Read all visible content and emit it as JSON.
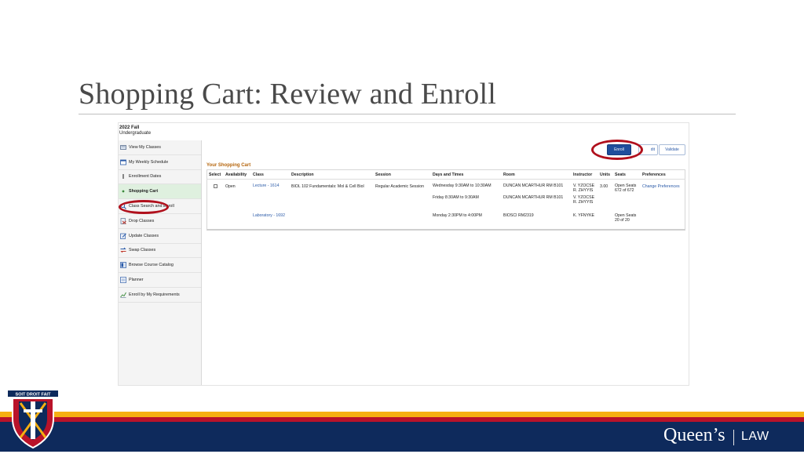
{
  "slide": {
    "title": "Shopping Cart: Review and Enroll"
  },
  "term": {
    "name": "2022 Fall",
    "career": "Undergraduate"
  },
  "sidebar": {
    "items": [
      {
        "label": "View My Classes",
        "icon": "view-classes-icon"
      },
      {
        "label": "My Weekly Schedule",
        "icon": "weekly-schedule-icon"
      },
      {
        "label": "Enrollment Dates",
        "icon": "enrollment-dates-icon"
      },
      {
        "label": "Shopping Cart",
        "icon": "shopping-cart-icon"
      },
      {
        "label": "Class Search and Enroll",
        "icon": "search-icon"
      },
      {
        "label": "Drop Classes",
        "icon": "drop-classes-icon"
      },
      {
        "label": "Update Classes",
        "icon": "update-classes-icon"
      },
      {
        "label": "Swap Classes",
        "icon": "swap-classes-icon"
      },
      {
        "label": "Browse Course Catalog",
        "icon": "catalog-icon"
      },
      {
        "label": "Planner",
        "icon": "planner-icon"
      },
      {
        "label": "Enroll by My Requirements",
        "icon": "requirements-icon"
      }
    ]
  },
  "toolbar": {
    "enroll": "Enroll",
    "edit": "dit",
    "validate": "Validate"
  },
  "cart": {
    "title": "Your Shopping Cart",
    "headers": [
      "Select",
      "Availability",
      "Class",
      "Description",
      "Session",
      "Days and Times",
      "Room",
      "Instructor",
      "Units",
      "Seats",
      "Preferences"
    ],
    "row1": {
      "availability": "Open",
      "class": "Lecture - 1614",
      "description": "BIOL 102 Fundamentals: Mol & Cell Biol",
      "session": "Regular Academic Session",
      "day1": "Wednesday  9:30AM to 10:30AM",
      "room1": "DUNCAN MCARTHUR RM B101",
      "instr1a": "V. YZOCSE",
      "instr1b": "R. ZHYYIS",
      "units": "3.00",
      "seats1a": "Open Seats",
      "seats1b": "672 of 672",
      "preferences": "Change Preferences",
      "day2": "Friday  8:30AM to 9:30AM",
      "room2": "DUNCAN MCARTHUR RM B101",
      "instr2a": "V. YZOCSE",
      "instr2b": "R. ZHYYIS"
    },
    "row2": {
      "class": "Laboratory - 1692",
      "day": "Monday  2:30PM to 4:00PM",
      "room": "BIOSCI RM2319",
      "instructor": "K. YFNYKE",
      "seats_a": "Open Seats",
      "seats_b": "20 of 20"
    }
  },
  "footer": {
    "brand": "Queen’s",
    "law": "LAW",
    "crest_text": "SOIT DROIT FAIT"
  },
  "colors": {
    "accent": "#1f4e9c",
    "highlight": "#b0101c",
    "gold": "#f6b012",
    "navy": "#0e2a5c",
    "cart_title": "#b5650c"
  }
}
